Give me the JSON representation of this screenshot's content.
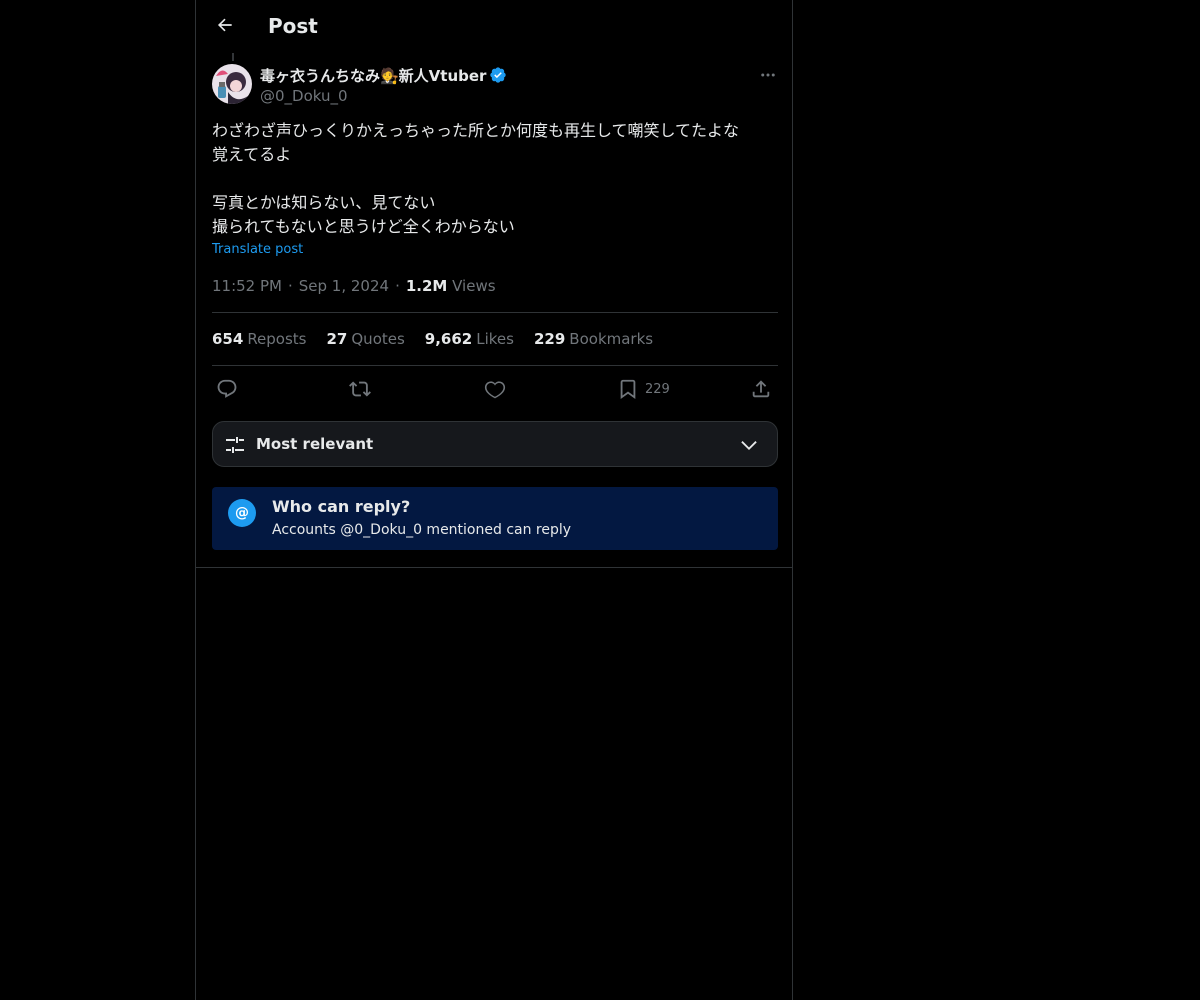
{
  "header": {
    "title": "Post"
  },
  "author": {
    "display_name": "毒ヶ衣うんちなみ🧑‍⚖️新人Vtuber",
    "handle": "@0_Doku_0",
    "verified": true
  },
  "post": {
    "lines": [
      "わざわざ声ひっくりかえっちゃった所とか何度も再生して嘲笑してたよな",
      "覚えてるよ",
      "",
      "写真とかは知らない、見てない",
      "撮られてもないと思うけど全くわからない"
    ],
    "translate_label": "Translate post",
    "time": "11:52 PM",
    "date": "Sep 1, 2024",
    "views_count": "1.2M",
    "views_label": "Views"
  },
  "stats": {
    "reposts": {
      "count": "654",
      "label": "Reposts"
    },
    "quotes": {
      "count": "27",
      "label": "Quotes"
    },
    "likes": {
      "count": "9,662",
      "label": "Likes"
    },
    "bookmarks": {
      "count": "229",
      "label": "Bookmarks"
    }
  },
  "actions": {
    "reply_icon": "reply-icon",
    "repost_icon": "repost-icon",
    "like_icon": "heart-icon",
    "bookmark_icon": "bookmark-icon",
    "bookmark_count": "229",
    "share_icon": "share-icon"
  },
  "sort": {
    "label": "Most relevant"
  },
  "reply_restriction": {
    "icon_symbol": "@",
    "title": "Who can reply?",
    "description": "Accounts @0_Doku_0 mentioned can reply"
  },
  "colors": {
    "background": "#000000",
    "accent": "#1d9bf0",
    "muted": "#71767b",
    "reply_box_bg": "#031841"
  }
}
